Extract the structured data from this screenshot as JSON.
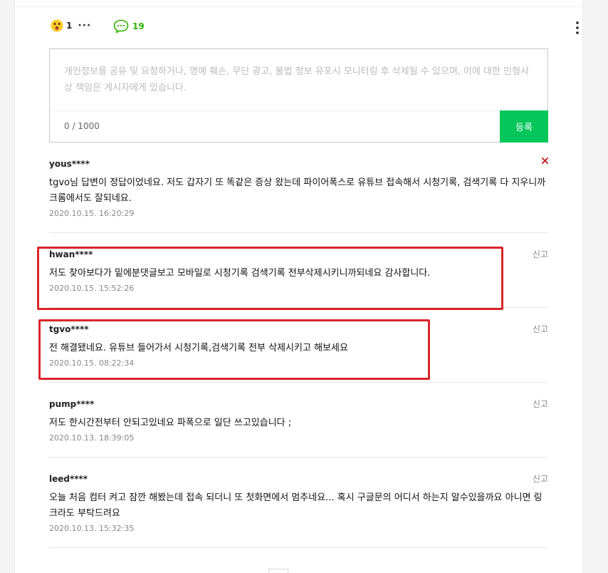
{
  "reactions": {
    "emoji_icon": "surprised-face-icon",
    "emoji_count": "1",
    "more": "···",
    "comment_icon": "speech-bubble-icon",
    "comment_count": "19",
    "menu_icon": "kebab-menu-icon"
  },
  "editor": {
    "placeholder": "개인정보를 공유 및 요청하거나, 명예 훼손, 무단 광고, 불법 정보 유포시 모니터링 후 삭제될 수 있으며, 이에 대한 민형사상 책임은 게시자에게 있습니다.",
    "counter": "0 / 1000",
    "submit_label": "등록"
  },
  "comments": [
    {
      "author": "yous****",
      "body": "tgvo님 답변이 정답이었네요. 저도 갑자기 또 똑같은 증상 왔는데 파이어폭스로 유튜브 접속해서 시청기록, 검색기록 다 지우니까 크롬에서도 잘되네요.",
      "date": "2020.10.15. 16:20:29",
      "action": "delete-icon"
    },
    {
      "author": "hwan****",
      "body": "저도 찾아보다가 밑에분댓글보고 모바일로 시청기록 검색기록 전부삭제시키니까되네요 감사합니다.",
      "date": "2020.10.15. 15:52:26",
      "action": "신고"
    },
    {
      "author": "tgvo****",
      "body": "전 해결됐네요. 유튜브 들어가서 시청기록,검색기록 전부 삭제시키고 해보세요",
      "date": "2020.10.15. 08:22:34",
      "action": "신고"
    },
    {
      "author": "pump****",
      "body": "저도 한시간전부터 안되고있네요 파폭으로 일단 쓰고있습니다 ;",
      "date": "2020.10.13. 18:39:05",
      "action": "신고"
    },
    {
      "author": "leed****",
      "body": "오늘 처음 컴터 켜고 잠깐 해봤는데 접속 되더니 또 첫화면에서 멈추네요... 혹시 구글문의 어디서 하는지 알수있을까요 아니면 링크라도 부탁드려요",
      "date": "2020.10.13. 15:32:35",
      "action": "신고"
    }
  ],
  "colors": {
    "accent_green": "#03c75a",
    "comment_count_green": "#2db400",
    "highlight_red": "#d9262b",
    "delete_red": "#c4161c"
  }
}
